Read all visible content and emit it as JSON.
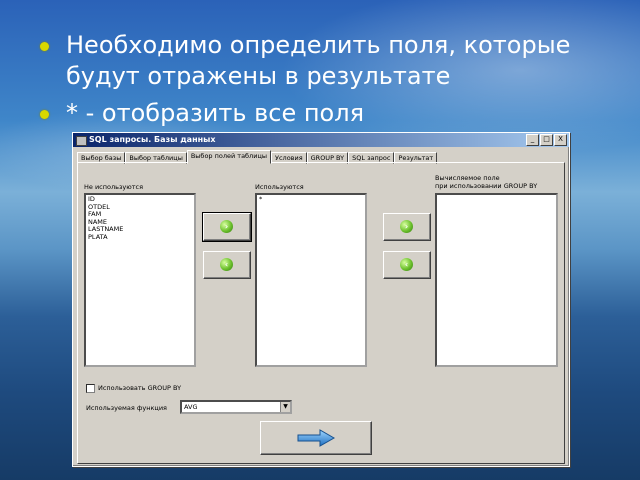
{
  "slide": {
    "bullets": [
      "Необходимо определить поля, которые будут отражены в результате",
      "* - отобразить все поля"
    ]
  },
  "window": {
    "title": "SQL запросы. Базы данных",
    "buttons": {
      "minimize": "_",
      "maximize": "□",
      "close": "X"
    }
  },
  "tabs": [
    "Выбор базы",
    "Выбор таблицы",
    "Выбор полей таблицы",
    "Условия",
    "GROUP BY",
    "SQL запрос",
    "Результат"
  ],
  "active_tab": "Выбор полей таблицы",
  "panel": {
    "unused_label": "Не используются",
    "unused_fields": [
      "ID",
      "OTDEL",
      "FAM",
      "NAME",
      "LASTNAME",
      "PLATA"
    ],
    "used_label": "Используются",
    "used_fields": [
      "*"
    ],
    "computed_label_1": "Вычисляемое поле",
    "computed_label_2": "при использовании GROUP BY",
    "group_by_checkbox": "Использовать GROUP BY",
    "function_label": "Используемая функция",
    "function_value": "AVG"
  },
  "icons": {
    "add_button": "green-arrow-right-icon",
    "remove_button": "green-arrow-left-icon",
    "next_button": "blue-arrow-right-icon"
  },
  "colors": {
    "title_bar_start": "#0a246a",
    "title_bar_end": "#a6caf0",
    "window_face": "#d4d0c8",
    "bullet_dot": "#d8d800",
    "button_ball": "#6cc02c",
    "next_arrow": "#2a8fe0"
  }
}
